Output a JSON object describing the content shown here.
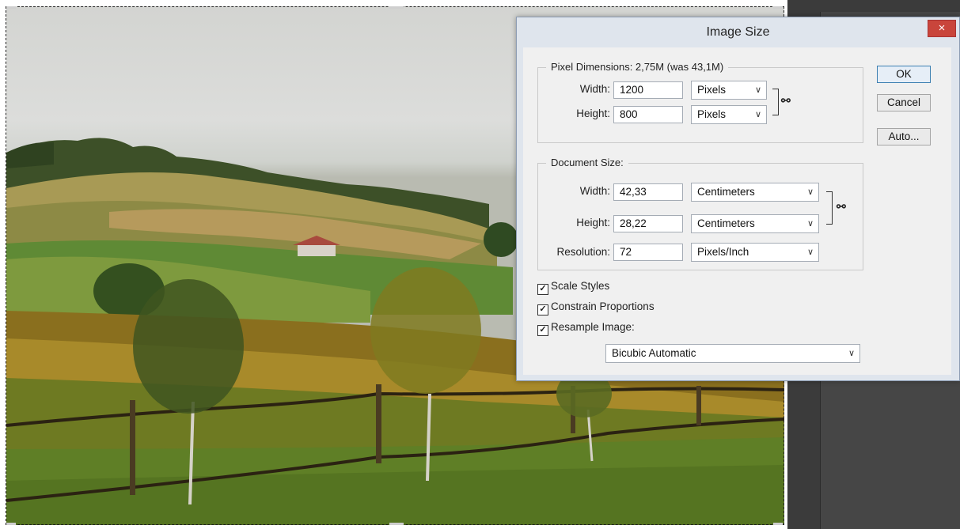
{
  "dialog": {
    "title": "Image Size",
    "close_glyph": "×",
    "buttons": {
      "ok": "OK",
      "cancel": "Cancel",
      "auto": "Auto..."
    },
    "pixel_dimensions": {
      "legend": "Pixel Dimensions:  2,75M (was 43,1M)",
      "width_label": "Width:",
      "width_value": "1200",
      "width_unit": "Pixels",
      "height_label": "Height:",
      "height_value": "800",
      "height_unit": "Pixels",
      "link_icon": "chain-link-icon"
    },
    "document_size": {
      "legend": "Document Size:",
      "width_label": "Width:",
      "width_value": "42,33",
      "width_unit": "Centimeters",
      "height_label": "Height:",
      "height_value": "28,22",
      "height_unit": "Centimeters",
      "resolution_label": "Resolution:",
      "resolution_value": "72",
      "resolution_unit": "Pixels/Inch",
      "link_icon": "chain-link-icon"
    },
    "options": {
      "scale_styles": {
        "label": "Scale Styles",
        "checked": true
      },
      "constrain_proportions": {
        "label": "Constrain Proportions",
        "checked": true
      },
      "resample_image": {
        "label": "Resample Image:",
        "checked": true
      }
    },
    "resample_method": "Bicubic Automatic",
    "check_glyph": "✓",
    "chevron_glyph": "∨"
  },
  "colors": {
    "dialog_frame": "#dfe5ed",
    "close_button": "#c9453b",
    "panel_dark": "#3b3b3b"
  }
}
